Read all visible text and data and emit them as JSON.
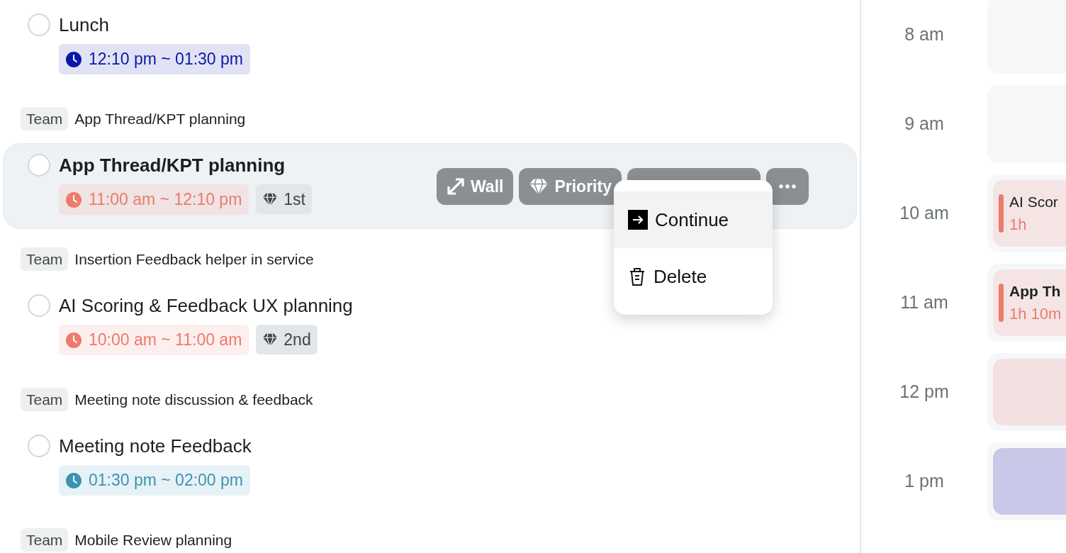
{
  "tasks": [
    {
      "title": "Lunch",
      "checked": false,
      "selected": false,
      "time": {
        "text": "12:10 pm ~ 01:30 pm",
        "color": "#0a17a8"
      }
    },
    {
      "group": {
        "tag": "Team",
        "title": "App Thread/KPT planning"
      },
      "title": "App Thread/KPT planning",
      "checked": false,
      "selected": true,
      "time": {
        "text": "11:00 am ~ 12:10 pm",
        "color": "#ec7b6c"
      },
      "priority": "1st"
    },
    {
      "group": {
        "tag": "Team",
        "title": "Insertion Feedback helper in service"
      },
      "title": "AI Scoring & Feedback UX planning",
      "checked": false,
      "selected": false,
      "time": {
        "text": "10:00 am ~ 11:00 am",
        "color": "#ec7b6c"
      },
      "priority": "2nd"
    },
    {
      "group": {
        "tag": "Team",
        "title": "Meeting note discussion & feedback"
      },
      "title": "Meeting note Feedback",
      "checked": false,
      "selected": false,
      "time": {
        "text": "01:30 pm ~ 02:00 pm",
        "color": "#3d93b3"
      }
    },
    {
      "group": {
        "tag": "Team",
        "title": "Mobile Review planning"
      }
    }
  ],
  "row_actions": [
    {
      "kind": "expand",
      "label": "Wall"
    },
    {
      "kind": "priority",
      "label": "Priority"
    },
    {
      "kind": "covered"
    },
    {
      "kind": "more"
    }
  ],
  "menu": {
    "items": [
      {
        "kind": "continue",
        "label": "Continue",
        "selected": true
      },
      {
        "kind": "delete",
        "label": "Delete",
        "selected": false
      }
    ]
  },
  "timeline": [
    {
      "hour": "8 am"
    },
    {
      "hour": "9 am"
    },
    {
      "hour": "10 am",
      "event": {
        "title": "AI Scor",
        "duration": "1h",
        "color": "#ec7b6c",
        "selected": false
      }
    },
    {
      "hour": "11 am",
      "event": {
        "title": "App Th",
        "duration": "1h 10m",
        "color": "#ec7b6c",
        "selected": true
      }
    },
    {
      "hour": "12 pm",
      "event": {
        "color": "#f3e0e0"
      }
    },
    {
      "hour": "1 pm",
      "event": {
        "color": "#c8c9e8"
      }
    }
  ]
}
